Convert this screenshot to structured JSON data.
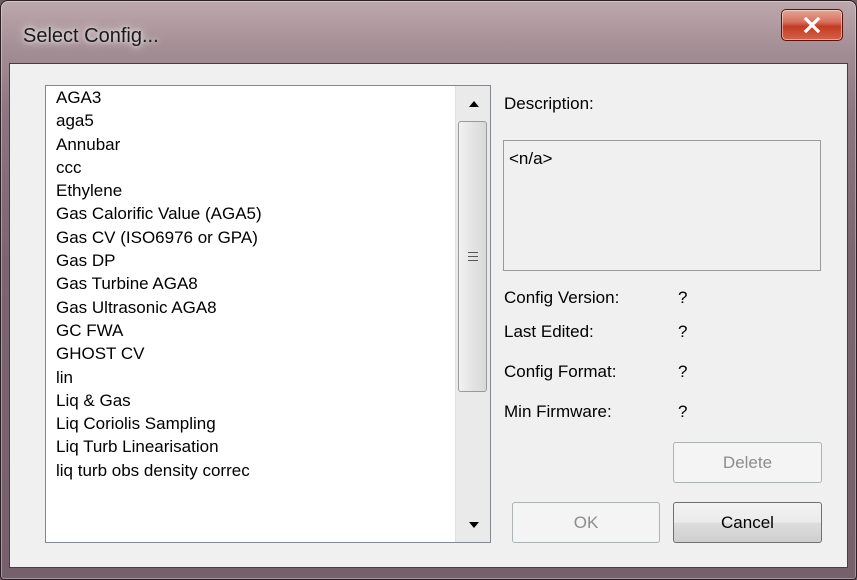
{
  "window": {
    "title": "Select Config..."
  },
  "config_list": {
    "items": [
      "AGA3",
      "aga5",
      "Annubar",
      "ccc",
      "Ethylene",
      "Gas Calorific Value (AGA5)",
      "Gas CV (ISO6976 or GPA)",
      "Gas DP",
      "Gas Turbine AGA8",
      "Gas Ultrasonic AGA8",
      "GC FWA",
      "GHOST CV",
      "lin",
      "Liq & Gas",
      "Liq Coriolis Sampling",
      "Liq Turb Linearisation",
      "liq turb obs density correc"
    ]
  },
  "details": {
    "description_label": "Description:",
    "description_value": "<n/a>",
    "config_version_label": "Config Version:",
    "config_version_value": "?",
    "last_edited_label": "Last Edited:",
    "last_edited_value": "?",
    "config_format_label": "Config Format:",
    "config_format_value": "?",
    "min_firmware_label": "Min Firmware:",
    "min_firmware_value": "?"
  },
  "buttons": {
    "delete": "Delete",
    "ok": "OK",
    "cancel": "Cancel"
  },
  "icons": {
    "close": "close-icon",
    "scroll_up": "scroll-up-arrow-icon",
    "scroll_down": "scroll-down-arrow-icon",
    "thumb_grip": "grip-icon"
  },
  "colors": {
    "close_button": "#c23b22",
    "dialog_background": "#f0f0f0",
    "disabled_text": "#8d8d8d"
  }
}
